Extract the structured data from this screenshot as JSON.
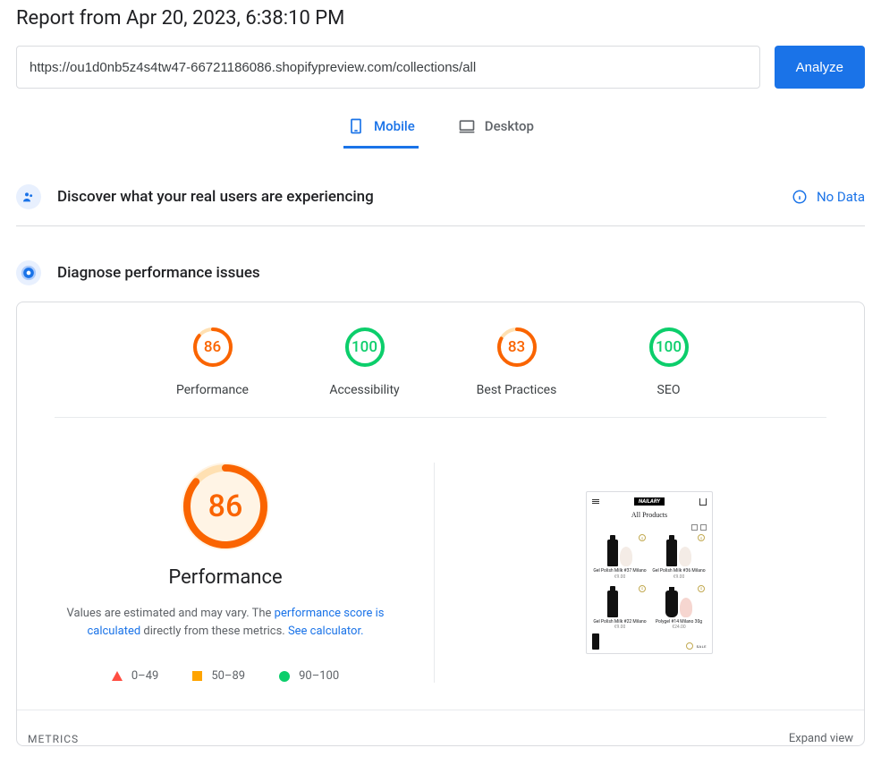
{
  "report_title": "Report from Apr 20, 2023, 6:38:10 PM",
  "url_value": "https://ou1d0nb5z4s4tw47-66721186086.shopifypreview.com/collections/all",
  "analyze_label": "Analyze",
  "tabs": {
    "mobile": "Mobile",
    "desktop": "Desktop"
  },
  "discover": {
    "title": "Discover what your real users are experiencing",
    "nodata": "No Data"
  },
  "diagnose": {
    "title": "Diagnose performance issues"
  },
  "scores": {
    "performance": {
      "label": "Performance",
      "value": 86
    },
    "accessibility": {
      "label": "Accessibility",
      "value": 100
    },
    "best_practices": {
      "label": "Best Practices",
      "value": 83
    },
    "seo": {
      "label": "SEO",
      "value": 100
    }
  },
  "main_score": {
    "value": 86,
    "heading": "Performance"
  },
  "desc": {
    "prefix": "Values are estimated and may vary. The ",
    "link1": "performance score is calculated",
    "mid": " directly from these metrics. ",
    "link2": "See calculator."
  },
  "legend": {
    "r1": "0–49",
    "r2": "50–89",
    "r3": "90–100"
  },
  "metrics": {
    "label": "METRICS",
    "expand": "Expand view"
  },
  "preview": {
    "logo": "NAILARY",
    "title": "All Products",
    "p1_name": "Gel Polish Milk #37 Milano",
    "p1_price": "€9.00",
    "p2_name": "Gel Polish Milk #36 Milano",
    "p2_price": "€9.00",
    "p3_name": "Gel Polish Milk #22 Milano",
    "p3_price": "€9.00",
    "p4_name": "Polygel #14 Milano 30g",
    "p4_price": "€24.00",
    "sale": "SALE"
  }
}
